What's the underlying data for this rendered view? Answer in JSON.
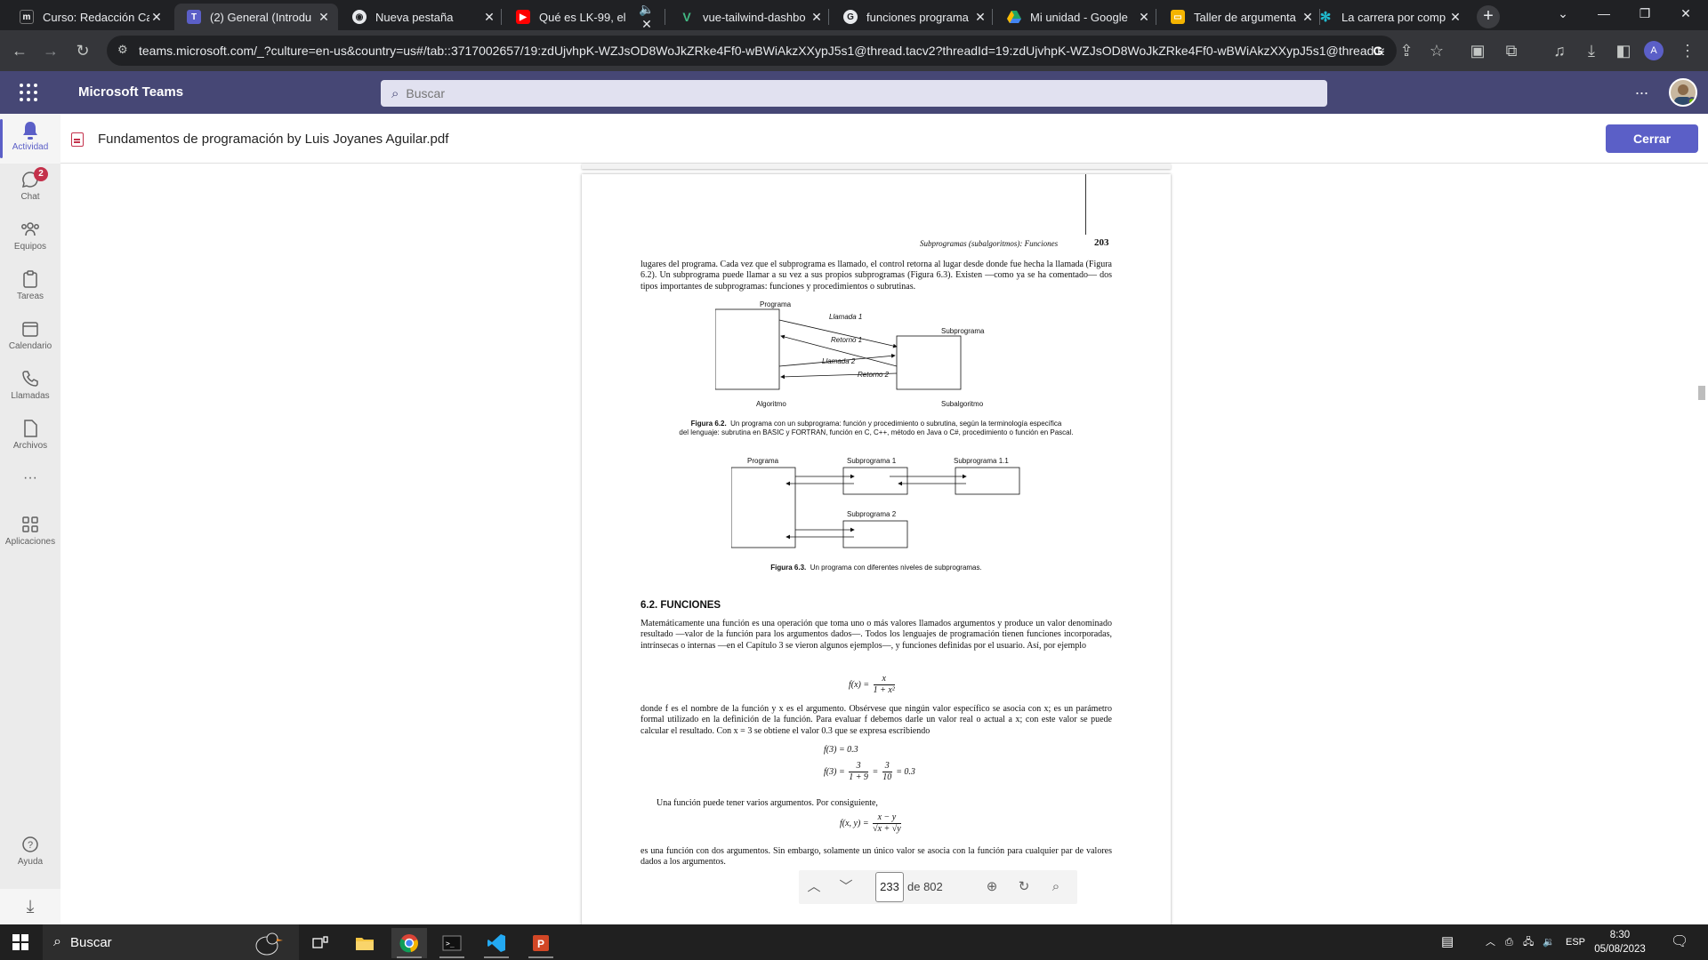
{
  "browser": {
    "tabs": [
      {
        "title": "Curso: Redacción Ca",
        "icon": "moodle-icon",
        "color": "#202124"
      },
      {
        "title": "(2) General (Introdu",
        "icon": "teams-icon",
        "color": "#5b5fc7"
      },
      {
        "title": "Nueva pestaña",
        "icon": "chrome-icon",
        "color": "#e8eaed"
      },
      {
        "title": "Qué es LK-99, el",
        "icon": "youtube-icon",
        "color": "#ff0000"
      },
      {
        "title": "vue-tailwind-dashbo",
        "icon": "vue-icon",
        "color": "#42b883"
      },
      {
        "title": "funciones programa",
        "icon": "google-icon",
        "color": "#e8eaed"
      },
      {
        "title": "Mi unidad - Google",
        "icon": "drive-icon",
        "color": "#1fa463"
      },
      {
        "title": "Taller de argumenta",
        "icon": "slides-icon",
        "color": "#f4b400"
      },
      {
        "title": "La carrera por comp",
        "icon": "perplexity-icon",
        "color": "#20b8cd"
      }
    ],
    "url": "teams.microsoft.com/_?culture=en-us&country=us#/tab::3717002657/19:zdUjvhpK-WZJsOD8WoJkZRke4Ff0-wBWiAkzXXypJ5s1@thread.tacv2?threadId=19:zdUjvhpK-WZJsOD8WoJkZRke4Ff0-wBWiAkzXXypJ5s1@thread.ta..."
  },
  "teams": {
    "app_name": "Microsoft Teams",
    "search_placeholder": "Buscar",
    "rail": [
      {
        "label": "Actividad",
        "icon": "bell-icon"
      },
      {
        "label": "Chat",
        "icon": "chat-icon",
        "badge": "2"
      },
      {
        "label": "Equipos",
        "icon": "teams-group-icon"
      },
      {
        "label": "Tareas",
        "icon": "clipboard-icon"
      },
      {
        "label": "Calendario",
        "icon": "calendar-icon"
      },
      {
        "label": "Llamadas",
        "icon": "phone-icon"
      },
      {
        "label": "Archivos",
        "icon": "file-icon"
      },
      {
        "label": "Aplicaciones",
        "icon": "apps-icon"
      },
      {
        "label": "Ayuda",
        "icon": "help-icon"
      }
    ],
    "more_label": "...",
    "accent": "#5b5fc7",
    "header_color": "#464775"
  },
  "document": {
    "title": "Fundamentos de programación by Luis Joyanes Aguilar.pdf",
    "close_label": "Cerrar",
    "running_head": "Subprogramas (subalgoritmos): Funciones",
    "page_number_printed": "203",
    "para1": "lugares del programa. Cada vez que el subprograma es llamado, el control retorna al lugar desde donde fue hecha la llamada (Figura 6.2). Un subprograma puede llamar a su vez a sus propios subprogramas (Figura 6.3). Existen —como ya se ha comentado— dos tipos importantes de subprogramas: funciones y procedimientos o subrutinas.",
    "fig62": {
      "programa": "Programa",
      "subprograma": "Subprograma",
      "algoritmo": "Algoritmo",
      "subalgoritmo": "Subalgoritmo",
      "llamada1": "Llamada 1",
      "retorno1": "Retorno 1",
      "llamada2": "Llamada 2",
      "retorno2": "Retorno 2",
      "caption_label": "Figura 6.2.",
      "caption_line1": "Un programa con un subprograma: función y procedimiento o subrutina, según la terminología específica",
      "caption_line2": "del lenguaje: subrutina en BASIC y FORTRAN, función en C, C++, método en Java o C#, procedimiento o función en Pascal."
    },
    "fig63": {
      "programa": "Programa",
      "sub1": "Subprograma 1",
      "sub11": "Subprograma 1.1",
      "sub2": "Subprograma 2",
      "caption_label": "Figura 6.3.",
      "caption_text": "Un programa con diferentes niveles de subprogramas."
    },
    "section_title": "6.2.  FUNCIONES",
    "para2": "Matemáticamente una función es una operación que toma uno o más valores llamados argumentos y produce un valor denominado resultado —valor de la función para los argumentos dados—. Todos los lenguajes de programación tienen funciones incorporadas, intrínsecas o internas —en el Capítulo 3 se vieron algunos ejemplos—, y funciones definidas por el usuario. Así, por ejemplo",
    "eq1_lhs": "f(x) =",
    "eq1_num": "x",
    "eq1_den": "1 + x²",
    "para3": "donde f es el nombre de la función y x es el argumento. Obsérvese que ningún valor específico se asocia con x; es un parámetro formal utilizado en la definición de la función. Para evaluar f debemos darle un valor real o actual a x; con este valor se puede calcular el resultado. Con x = 3 se obtiene el valor 0.3 que se expresa escribiendo",
    "eq2": "f(3) = 0.3",
    "eq3_lhs": "f(3) =",
    "eq3_num1": "3",
    "eq3_den1": "1 + 9",
    "eq3_mid": "=",
    "eq3_num2": "3",
    "eq3_den2": "10",
    "eq3_rhs": "= 0.3",
    "para4": "Una función puede tener varios argumentos. Por consiguiente,",
    "eq4_lhs": "f(x, y) =",
    "eq4_num": "x − y",
    "eq4_den": "√x + √y",
    "para5": "es una función con dos argumentos. Sin embargo, solamente un único valor se asocia con la función para cualquier par de valores dados a los argumentos.",
    "nav": {
      "current_page": "233",
      "total": "de 802"
    }
  },
  "taskbar": {
    "search_label": "Buscar",
    "language": "ESP",
    "time": "8:30",
    "date": "05/08/2023"
  }
}
